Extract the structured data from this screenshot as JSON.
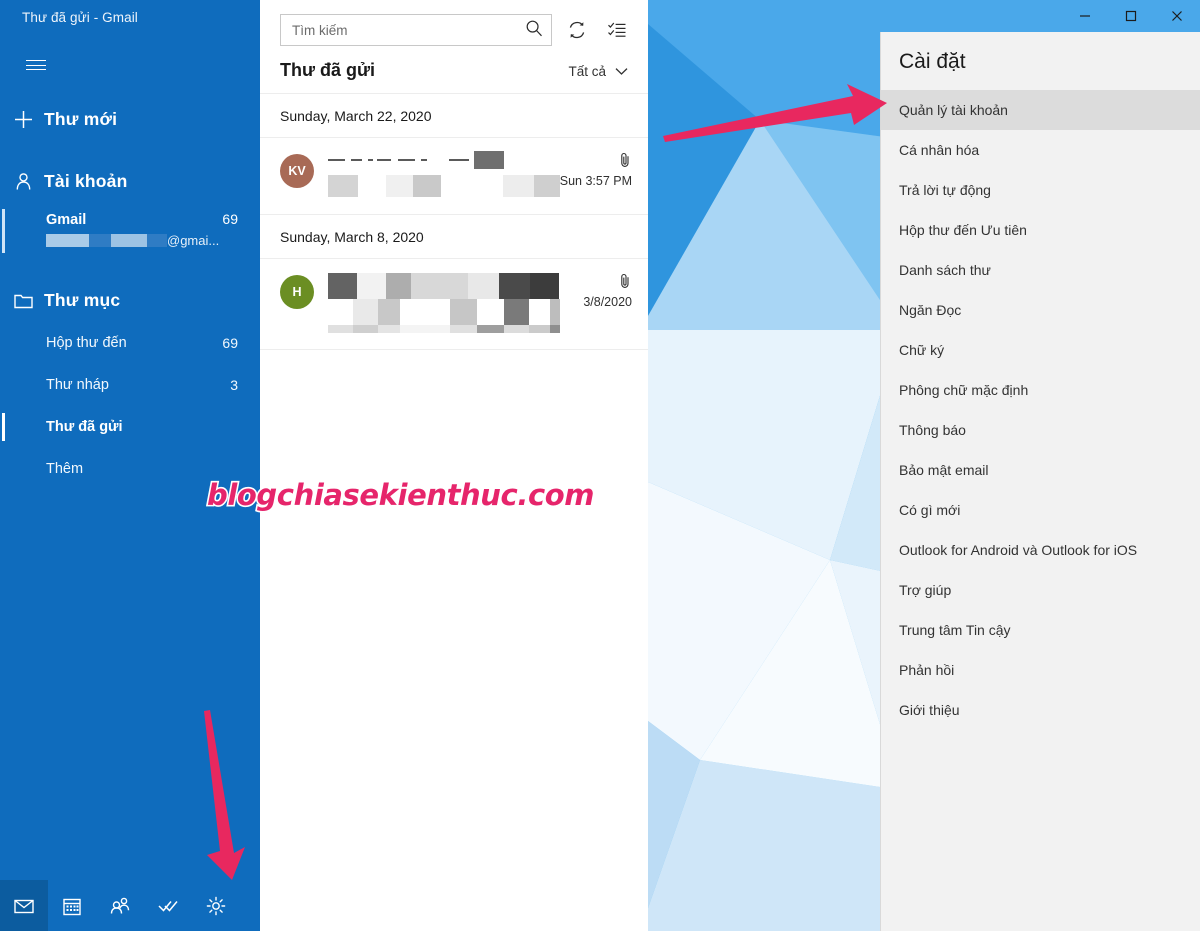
{
  "window": {
    "title": "Thư đã gửi - Gmail",
    "controls": [
      {
        "name": "minimize",
        "glyph": "minimize-icon"
      },
      {
        "name": "maximize",
        "glyph": "maximize-icon"
      },
      {
        "name": "close",
        "glyph": "close-icon"
      }
    ]
  },
  "nav": {
    "hamburger_label": "",
    "new_mail": {
      "label": "Thư mới",
      "icon": "plus-icon"
    },
    "accounts_header": {
      "label": "Tài khoản",
      "icon": "person-icon"
    },
    "account": {
      "name": "Gmail",
      "count": "69",
      "email_suffix": "@gmai..."
    },
    "folders_header": {
      "label": "Thư mục",
      "icon": "folder-icon"
    },
    "folders": [
      {
        "label": "Hộp thư đến",
        "count": "69",
        "selected": false
      },
      {
        "label": "Thư nháp",
        "count": "3",
        "selected": false
      },
      {
        "label": "Thư đã gửi",
        "count": "",
        "selected": true
      },
      {
        "label": "Thêm",
        "count": "",
        "selected": false
      }
    ],
    "taskbar": [
      {
        "name": "mail",
        "icon": "mail-icon",
        "active": true
      },
      {
        "name": "calendar",
        "icon": "calendar-icon",
        "active": false
      },
      {
        "name": "people",
        "icon": "people-icon",
        "active": false
      },
      {
        "name": "tasks",
        "icon": "tasks-check-icon",
        "active": false
      },
      {
        "name": "settings",
        "icon": "gear-icon",
        "active": false
      }
    ]
  },
  "list": {
    "search_placeholder": "Tìm kiếm",
    "search_value": "",
    "refresh_icon": "sync-icon",
    "select_icon": "select-mode-icon",
    "header_title": "Thư đã gửi",
    "filter_label": "Tất cả",
    "groups": [
      {
        "day": "Sunday, March 22, 2020",
        "messages": [
          {
            "avatar_initials": "KV",
            "avatar_color": "#a86a56",
            "time": "Sun 3:57 PM",
            "has_attachment": true,
            "attachment_icon": "paperclip-icon",
            "redacted": true
          }
        ]
      },
      {
        "day": "Sunday, March 8, 2020",
        "messages": [
          {
            "avatar_initials": "H",
            "avatar_color": "#6b8e23",
            "time": "3/8/2020",
            "has_attachment": true,
            "attachment_icon": "paperclip-icon",
            "redacted": true
          }
        ]
      }
    ]
  },
  "watermark": {
    "text": "blogchiasekienthuc.com",
    "color": "#e6256b"
  },
  "settings": {
    "title": "Cài đặt",
    "items": [
      {
        "label": "Quản lý tài khoản",
        "selected": true
      },
      {
        "label": "Cá nhân hóa",
        "selected": false
      },
      {
        "label": "Trả lời tự động",
        "selected": false
      },
      {
        "label": "Hộp thư đến Ưu tiên",
        "selected": false
      },
      {
        "label": "Danh sách thư",
        "selected": false
      },
      {
        "label": "Ngăn Đọc",
        "selected": false
      },
      {
        "label": "Chữ ký",
        "selected": false
      },
      {
        "label": "Phông chữ mặc định",
        "selected": false
      },
      {
        "label": "Thông báo",
        "selected": false
      },
      {
        "label": "Bảo mật email",
        "selected": false
      },
      {
        "label": "Có gì mới",
        "selected": false
      },
      {
        "label": "Outlook for Android và Outlook for iOS",
        "selected": false
      },
      {
        "label": "Trợ giúp",
        "selected": false
      },
      {
        "label": "Trung tâm Tin cậy",
        "selected": false
      },
      {
        "label": "Phản hồi",
        "selected": false
      },
      {
        "label": "Giới thiệu",
        "selected": false
      }
    ]
  },
  "annotations": {
    "arrow_to_account_settings": {
      "color": "#e8285f"
    },
    "arrow_to_gear": {
      "color": "#e8285f"
    }
  },
  "colors": {
    "nav_blue": "#0f6cbd",
    "nav_blue_dark": "#0c5c9f",
    "settings_bg": "#f2f2f2",
    "settings_selected": "#dcdcdc"
  }
}
